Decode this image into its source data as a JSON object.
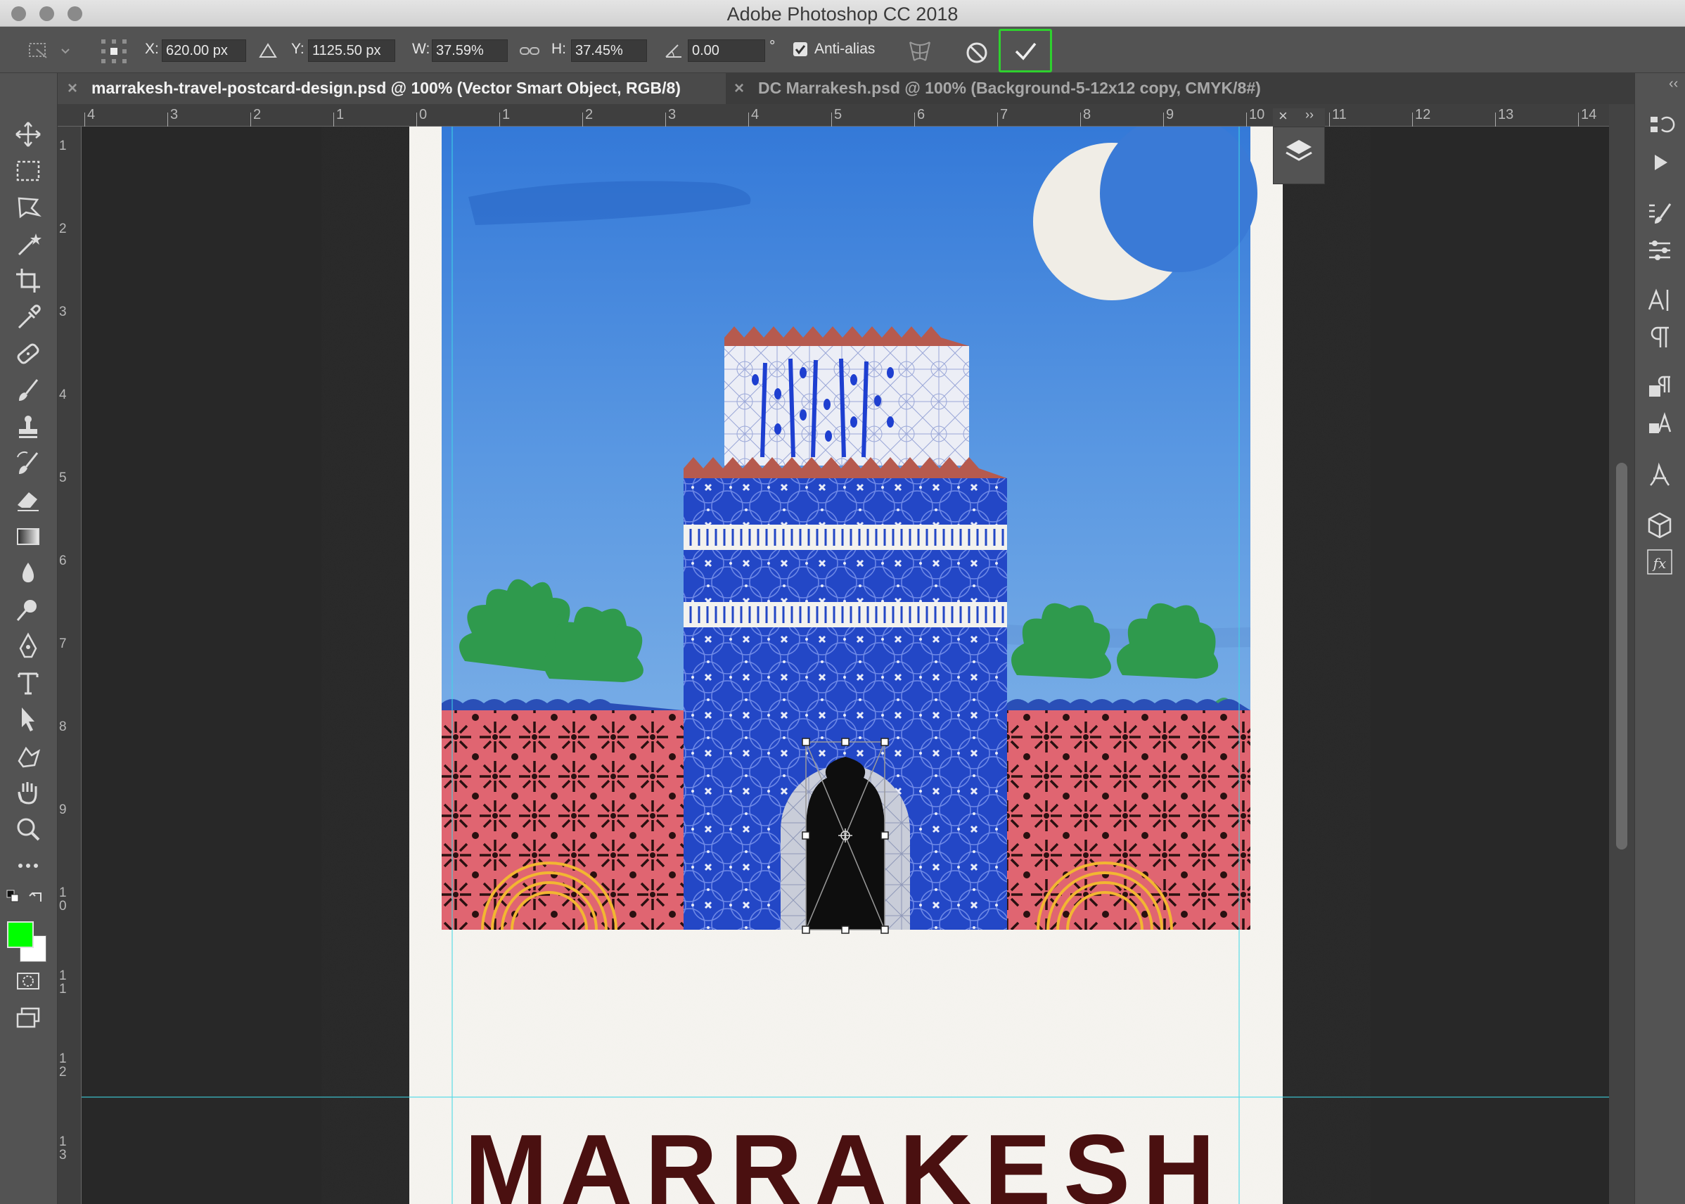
{
  "window": {
    "title": "Adobe Photoshop CC 2018"
  },
  "options": {
    "x_label": "X:",
    "x_value": "620.00 px",
    "y_label": "Y:",
    "y_value": "1125.50 px",
    "w_label": "W:",
    "w_value": "37.59%",
    "h_label": "H:",
    "h_value": "37.45%",
    "angle_value": "0.00",
    "angle_unit": "°",
    "antialias_label": "Anti-alias",
    "antialias_checked": true
  },
  "tabs": [
    {
      "label": "marrakesh-travel-postcard-design.psd @ 100% (Vector Smart Object, RGB/8)",
      "active": true
    },
    {
      "label": "DC Marrakesh.psd @ 100% (Background-5-12x12 copy, CMYK/8#)",
      "active": false
    }
  ],
  "ruler_h": [
    "4",
    "3",
    "2",
    "1",
    "0",
    "1",
    "2",
    "3",
    "4",
    "5",
    "6",
    "7",
    "8",
    "9",
    "10",
    "11",
    "12",
    "13",
    "14"
  ],
  "ruler_v": [
    "1",
    "2",
    "3",
    "4",
    "5",
    "6",
    "7",
    "8",
    "9",
    "1\n0",
    "1\n1",
    "1\n2",
    "1\n3"
  ],
  "artwork": {
    "heading": "MARRAKESH"
  },
  "toolbar_icons": [
    "move-icon",
    "marquee-icon",
    "lasso-icon",
    "magic-wand-icon",
    "crop-icon",
    "eyedropper-icon",
    "healing-brush-icon",
    "brush-icon",
    "clone-stamp-icon",
    "history-brush-icon",
    "eraser-icon",
    "gradient-icon",
    "blur-icon",
    "dodge-icon",
    "pen-icon",
    "type-icon",
    "path-selection-icon",
    "shape-icon",
    "hand-icon",
    "zoom-icon",
    "more-tools-icon"
  ],
  "colors": {
    "foreground": "#00ff00",
    "background": "#ffffff",
    "commit_border": "#2ed12e"
  }
}
